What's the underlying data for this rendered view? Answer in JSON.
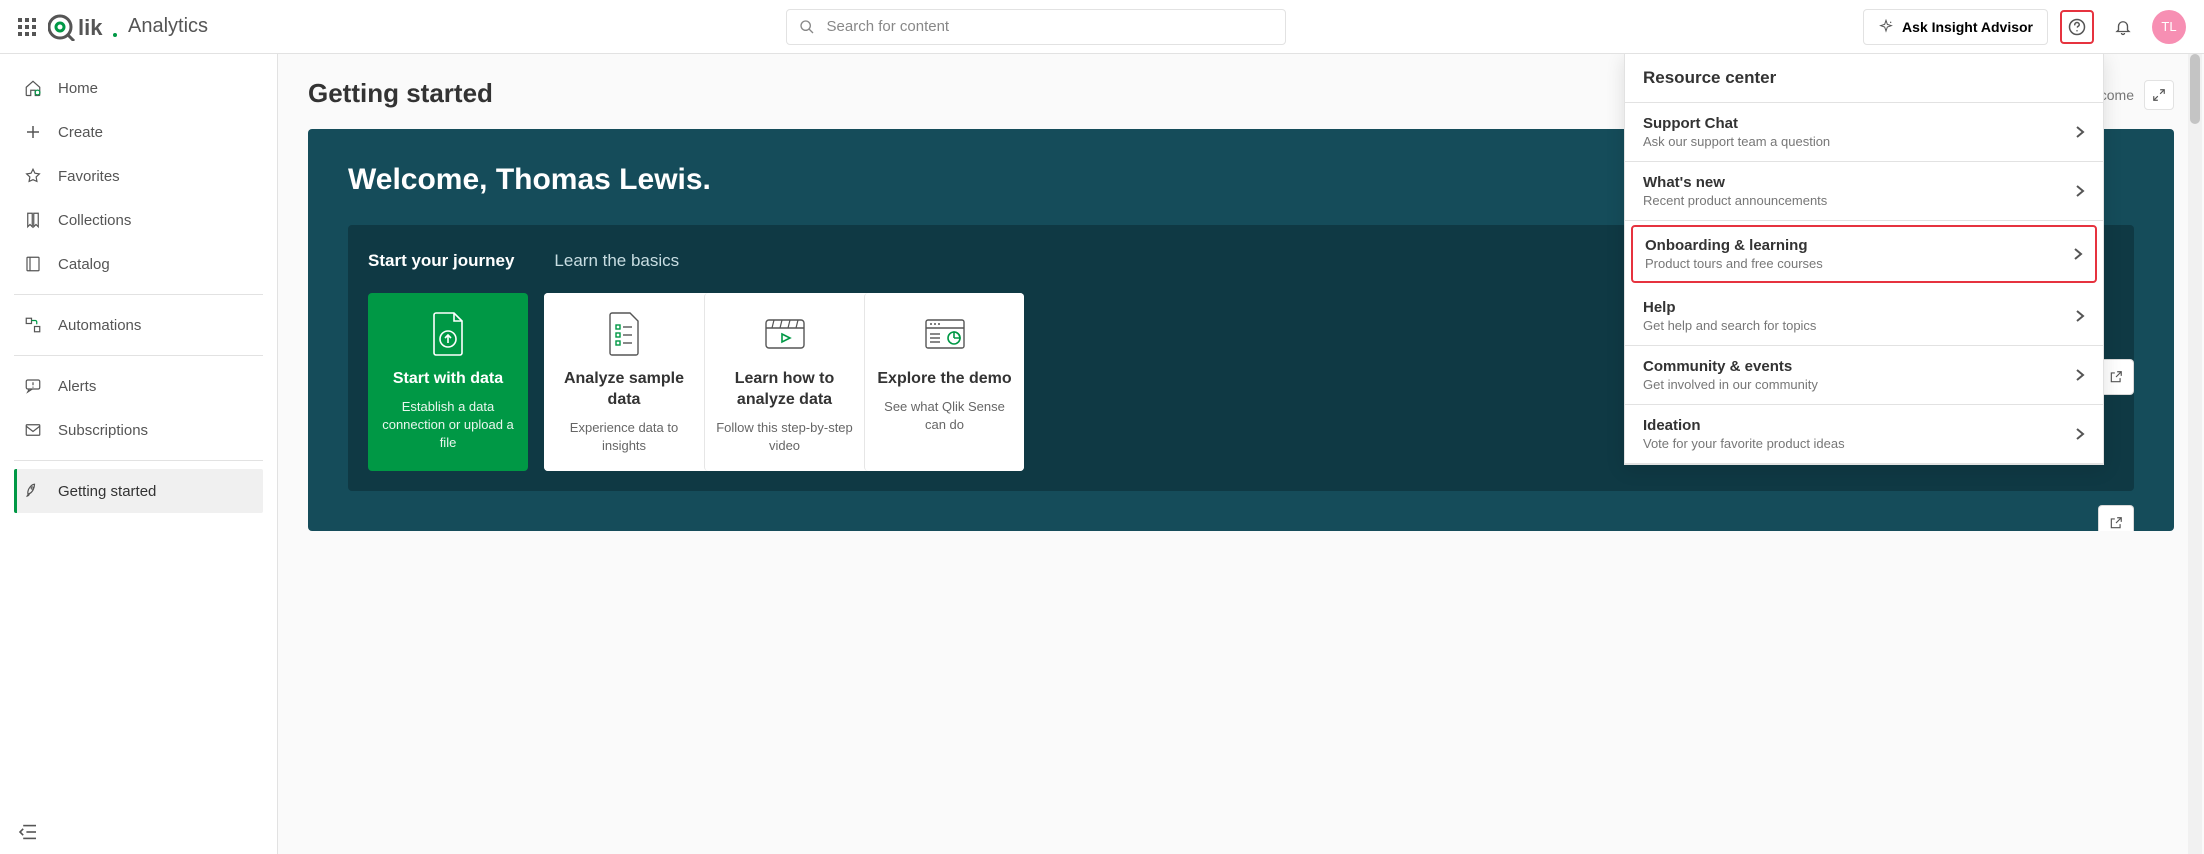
{
  "header": {
    "product": "Analytics",
    "search_placeholder": "Search for content",
    "ask_label": "Ask Insight Advisor",
    "avatar_initials": "TL"
  },
  "sidebar": {
    "items": [
      {
        "label": "Home"
      },
      {
        "label": "Create"
      },
      {
        "label": "Favorites"
      },
      {
        "label": "Collections"
      },
      {
        "label": "Catalog"
      },
      {
        "label": "Automations"
      },
      {
        "label": "Alerts"
      },
      {
        "label": "Subscriptions"
      },
      {
        "label": "Getting started"
      }
    ]
  },
  "page": {
    "title": "Getting started",
    "welcome_chip": "Welcome"
  },
  "hero": {
    "heading": "Welcome, Thomas Lewis.",
    "tabs": [
      {
        "label": "Start your journey"
      },
      {
        "label": "Learn the basics"
      }
    ],
    "cards": [
      {
        "title": "Start with data",
        "sub": "Establish a data connection or upload a file"
      },
      {
        "title": "Analyze sample data",
        "sub": "Experience data to insights"
      },
      {
        "title": "Learn how to analyze data",
        "sub": "Follow this step-by-step video"
      },
      {
        "title": "Explore the demo",
        "sub": "See what Qlik Sense can do"
      }
    ]
  },
  "panel": {
    "title": "Resource center",
    "items": [
      {
        "title": "Support Chat",
        "sub": "Ask our support team a question"
      },
      {
        "title": "What's new",
        "sub": "Recent product announcements"
      },
      {
        "title": "Onboarding & learning",
        "sub": "Product tours and free courses"
      },
      {
        "title": "Help",
        "sub": "Get help and search for topics"
      },
      {
        "title": "Community & events",
        "sub": "Get involved in our community"
      },
      {
        "title": "Ideation",
        "sub": "Vote for your favorite product ideas"
      }
    ]
  }
}
